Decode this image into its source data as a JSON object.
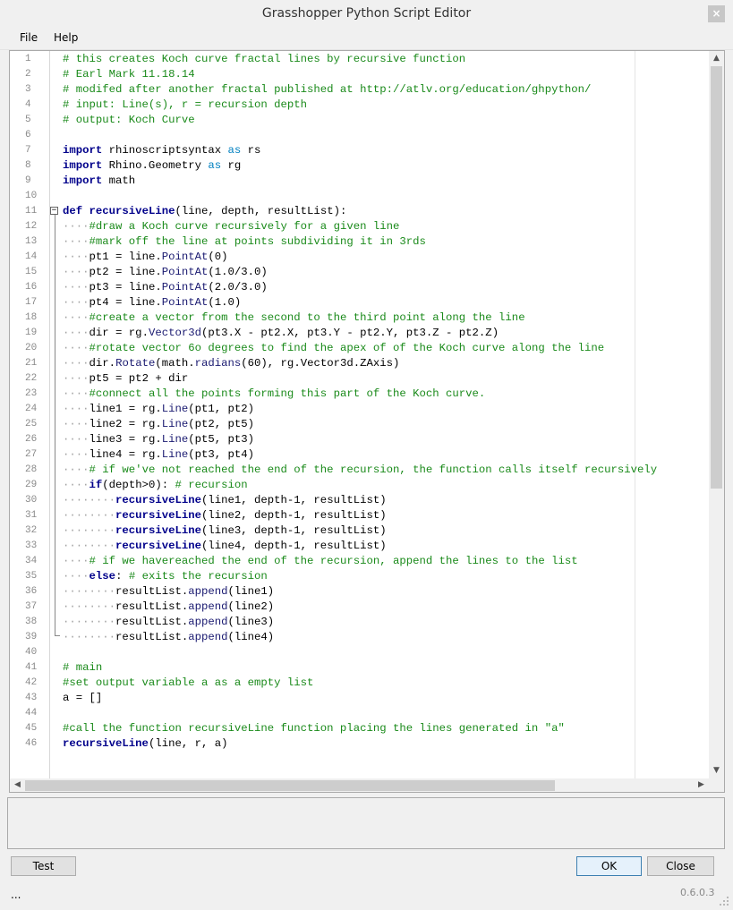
{
  "window": {
    "title": "Grasshopper Python Script Editor",
    "close_glyph": "×"
  },
  "menu": {
    "file": "File",
    "help": "Help"
  },
  "code_lines": [
    {
      "n": "1",
      "t": [
        [
          "cm",
          "# this creates Koch curve fractal lines by recursive function"
        ]
      ]
    },
    {
      "n": "2",
      "t": [
        [
          "cm",
          "# Earl Mark 11.18.14"
        ]
      ]
    },
    {
      "n": "3",
      "t": [
        [
          "cm",
          "# modifed after another fractal published at http://atlv.org/education/ghpython/"
        ]
      ]
    },
    {
      "n": "4",
      "t": [
        [
          "cm",
          "# input: Line(s), r = recursion depth"
        ]
      ]
    },
    {
      "n": "5",
      "t": [
        [
          "cm",
          "# output: Koch Curve"
        ]
      ]
    },
    {
      "n": "6",
      "t": []
    },
    {
      "n": "7",
      "t": [
        [
          "kw",
          "import"
        ],
        [
          "",
          " rhinoscriptsyntax "
        ],
        [
          "kw2",
          "as"
        ],
        [
          "",
          " rs"
        ]
      ]
    },
    {
      "n": "8",
      "t": [
        [
          "kw",
          "import"
        ],
        [
          "",
          " Rhino.Geometry "
        ],
        [
          "kw2",
          "as"
        ],
        [
          "",
          " rg"
        ]
      ]
    },
    {
      "n": "9",
      "t": [
        [
          "kw",
          "import"
        ],
        [
          "",
          " math"
        ]
      ]
    },
    {
      "n": "10",
      "t": []
    },
    {
      "n": "11",
      "t": [
        [
          "kw",
          "def"
        ],
        [
          "",
          " "
        ],
        [
          "fn",
          "recursiveLine"
        ],
        [
          "",
          "(line, depth, resultList):"
        ]
      ]
    },
    {
      "n": "12",
      "t": [
        [
          "ws",
          "····"
        ],
        [
          "cm",
          "#draw a Koch curve recursively for a given line"
        ]
      ]
    },
    {
      "n": "13",
      "t": [
        [
          "ws",
          "····"
        ],
        [
          "cm",
          "#mark off the line at points subdividing it in 3rds"
        ]
      ]
    },
    {
      "n": "14",
      "t": [
        [
          "ws",
          "····"
        ],
        [
          "",
          "pt1 = line."
        ],
        [
          "at",
          "PointAt"
        ],
        [
          "",
          "(0)"
        ]
      ]
    },
    {
      "n": "15",
      "t": [
        [
          "ws",
          "····"
        ],
        [
          "",
          "pt2 = line."
        ],
        [
          "at",
          "PointAt"
        ],
        [
          "",
          "(1.0/3.0)"
        ]
      ]
    },
    {
      "n": "16",
      "t": [
        [
          "ws",
          "····"
        ],
        [
          "",
          "pt3 = line."
        ],
        [
          "at",
          "PointAt"
        ],
        [
          "",
          "(2.0/3.0)"
        ]
      ]
    },
    {
      "n": "17",
      "t": [
        [
          "ws",
          "····"
        ],
        [
          "",
          "pt4 = line."
        ],
        [
          "at",
          "PointAt"
        ],
        [
          "",
          "(1.0)"
        ]
      ]
    },
    {
      "n": "18",
      "t": [
        [
          "ws",
          "····"
        ],
        [
          "cm",
          "#create a vector from the second to the third point along the line"
        ]
      ]
    },
    {
      "n": "19",
      "t": [
        [
          "ws",
          "····"
        ],
        [
          "",
          "dir = rg."
        ],
        [
          "at",
          "Vector3d"
        ],
        [
          "",
          "(pt3.X - pt2.X, pt3.Y - pt2.Y, pt3.Z - pt2.Z)"
        ]
      ]
    },
    {
      "n": "20",
      "t": [
        [
          "ws",
          "····"
        ],
        [
          "cm",
          "#rotate vector 6o degrees to find the apex of of the Koch curve along the line"
        ]
      ]
    },
    {
      "n": "21",
      "t": [
        [
          "ws",
          "····"
        ],
        [
          "",
          "dir."
        ],
        [
          "at",
          "Rotate"
        ],
        [
          "",
          "(math."
        ],
        [
          "at",
          "radians"
        ],
        [
          "",
          "(60), rg.Vector3d.ZAxis)"
        ]
      ]
    },
    {
      "n": "22",
      "t": [
        [
          "ws",
          "····"
        ],
        [
          "",
          "pt5 = pt2 + dir"
        ]
      ]
    },
    {
      "n": "23",
      "t": [
        [
          "ws",
          "····"
        ],
        [
          "cm",
          "#connect all the points forming this part of the Koch curve."
        ]
      ]
    },
    {
      "n": "24",
      "t": [
        [
          "ws",
          "····"
        ],
        [
          "",
          "line1 = rg."
        ],
        [
          "at",
          "Line"
        ],
        [
          "",
          "(pt1, pt2)"
        ]
      ]
    },
    {
      "n": "25",
      "t": [
        [
          "ws",
          "····"
        ],
        [
          "",
          "line2 = rg."
        ],
        [
          "at",
          "Line"
        ],
        [
          "",
          "(pt2, pt5)"
        ]
      ]
    },
    {
      "n": "26",
      "t": [
        [
          "ws",
          "····"
        ],
        [
          "",
          "line3 = rg."
        ],
        [
          "at",
          "Line"
        ],
        [
          "",
          "(pt5, pt3)"
        ]
      ]
    },
    {
      "n": "27",
      "t": [
        [
          "ws",
          "····"
        ],
        [
          "",
          "line4 = rg."
        ],
        [
          "at",
          "Line"
        ],
        [
          "",
          "(pt3, pt4)"
        ]
      ]
    },
    {
      "n": "28",
      "t": [
        [
          "ws",
          "····"
        ],
        [
          "cm",
          "# if we've not reached the end of the recursion, the function calls itself recursively"
        ]
      ]
    },
    {
      "n": "29",
      "t": [
        [
          "ws",
          "····"
        ],
        [
          "kw",
          "if"
        ],
        [
          "",
          "(depth>0): "
        ],
        [
          "cm",
          "# recursion"
        ]
      ]
    },
    {
      "n": "30",
      "t": [
        [
          "ws",
          "········"
        ],
        [
          "fn",
          "recursiveLine"
        ],
        [
          "",
          "(line1, depth-1, resultList)"
        ]
      ]
    },
    {
      "n": "31",
      "t": [
        [
          "ws",
          "········"
        ],
        [
          "fn",
          "recursiveLine"
        ],
        [
          "",
          "(line2, depth-1, resultList)"
        ]
      ]
    },
    {
      "n": "32",
      "t": [
        [
          "ws",
          "········"
        ],
        [
          "fn",
          "recursiveLine"
        ],
        [
          "",
          "(line3, depth-1, resultList)"
        ]
      ]
    },
    {
      "n": "33",
      "t": [
        [
          "ws",
          "········"
        ],
        [
          "fn",
          "recursiveLine"
        ],
        [
          "",
          "(line4, depth-1, resultList)"
        ]
      ]
    },
    {
      "n": "34",
      "t": [
        [
          "ws",
          "····"
        ],
        [
          "cm",
          "# if we havereached the end of the recursion, append the lines to the list"
        ]
      ]
    },
    {
      "n": "35",
      "t": [
        [
          "ws",
          "····"
        ],
        [
          "kw",
          "else"
        ],
        [
          "",
          ": "
        ],
        [
          "cm",
          "# exits the recursion"
        ]
      ]
    },
    {
      "n": "36",
      "t": [
        [
          "ws",
          "········"
        ],
        [
          "",
          "resultList."
        ],
        [
          "at",
          "append"
        ],
        [
          "",
          "(line1)"
        ]
      ]
    },
    {
      "n": "37",
      "t": [
        [
          "ws",
          "········"
        ],
        [
          "",
          "resultList."
        ],
        [
          "at",
          "append"
        ],
        [
          "",
          "(line2)"
        ]
      ]
    },
    {
      "n": "38",
      "t": [
        [
          "ws",
          "········"
        ],
        [
          "",
          "resultList."
        ],
        [
          "at",
          "append"
        ],
        [
          "",
          "(line3)"
        ]
      ]
    },
    {
      "n": "39",
      "t": [
        [
          "ws",
          "········"
        ],
        [
          "",
          "resultList."
        ],
        [
          "at",
          "append"
        ],
        [
          "",
          "(line4)"
        ]
      ]
    },
    {
      "n": "40",
      "t": []
    },
    {
      "n": "41",
      "t": [
        [
          "cm",
          "# main"
        ]
      ]
    },
    {
      "n": "42",
      "t": [
        [
          "cm",
          "#set output variable a as a empty list"
        ]
      ]
    },
    {
      "n": "43",
      "t": [
        [
          "",
          "a = []"
        ]
      ]
    },
    {
      "n": "44",
      "t": []
    },
    {
      "n": "45",
      "t": [
        [
          "cm",
          "#call the function recursiveLine function placing the lines generated in \"a\""
        ]
      ]
    },
    {
      "n": "46",
      "t": [
        [
          "fn",
          "recursiveLine"
        ],
        [
          "",
          "(line, r, a)"
        ]
      ]
    }
  ],
  "buttons": {
    "test": "Test",
    "ok": "OK",
    "close": "Close"
  },
  "status": {
    "left": "...",
    "version": "0.6.0.3"
  },
  "colors": {
    "comment": "#1a8a1a",
    "keyword": "#00008b",
    "keyword_as": "#0080c0",
    "accent_button": "#3c7fb1"
  },
  "icons": {
    "close": "close-icon",
    "scroll_up": "chevron-up-icon",
    "scroll_down": "chevron-down-icon",
    "scroll_left": "chevron-left-icon",
    "scroll_right": "chevron-right-icon",
    "fold": "collapse-icon",
    "grip": "resize-grip-icon"
  }
}
